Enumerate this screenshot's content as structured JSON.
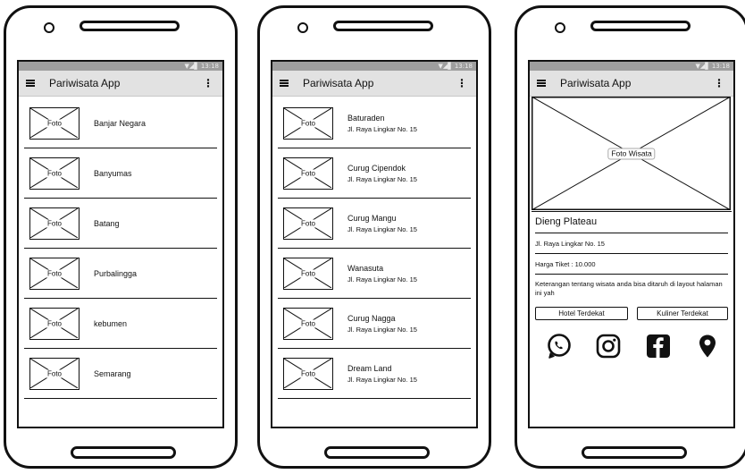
{
  "app": {
    "title": "Pariwisata App",
    "status_text": "▼◢▋ 13:18"
  },
  "screen1": {
    "items": [
      {
        "thumb": "Foto",
        "label": "Banjar Negara"
      },
      {
        "thumb": "Foto",
        "label": "Banyumas"
      },
      {
        "thumb": "Foto",
        "label": "Batang"
      },
      {
        "thumb": "Foto",
        "label": "Purbalingga"
      },
      {
        "thumb": "Foto",
        "label": "kebumen"
      },
      {
        "thumb": "Foto",
        "label": "Semarang"
      }
    ]
  },
  "screen2": {
    "items": [
      {
        "thumb": "Foto",
        "label": "Baturaden",
        "address": "Jl. Raya Lingkar No. 15"
      },
      {
        "thumb": "Foto",
        "label": "Curug Cipendok",
        "address": "Jl. Raya Lingkar No. 15"
      },
      {
        "thumb": "Foto",
        "label": "Curug Mangu",
        "address": "Jl. Raya Lingkar No. 15"
      },
      {
        "thumb": "Foto",
        "label": "Wanasuta",
        "address": "Jl. Raya Lingkar No. 15"
      },
      {
        "thumb": "Foto",
        "label": "Curug Nagga",
        "address": "Jl. Raya Lingkar No. 15"
      },
      {
        "thumb": "Foto",
        "label": "Dream Land",
        "address": "Jl. Raya Lingkar No. 15"
      }
    ]
  },
  "screen3": {
    "photo_label": "Foto Wisata",
    "name": "Dieng Plateau",
    "address": "Jl. Raya Lingkar No. 15",
    "price": "Harga Tiket : 10.000",
    "description": "Keterangan tentang wisata anda bisa ditaruh di layout halaman ini yah",
    "hotel_button": "Hotel Terdekat",
    "kuliner_button": "Kuliner Terdekat",
    "social_icons": [
      "whatsapp-icon",
      "instagram-icon",
      "facebook-icon",
      "location-pin-icon"
    ]
  }
}
